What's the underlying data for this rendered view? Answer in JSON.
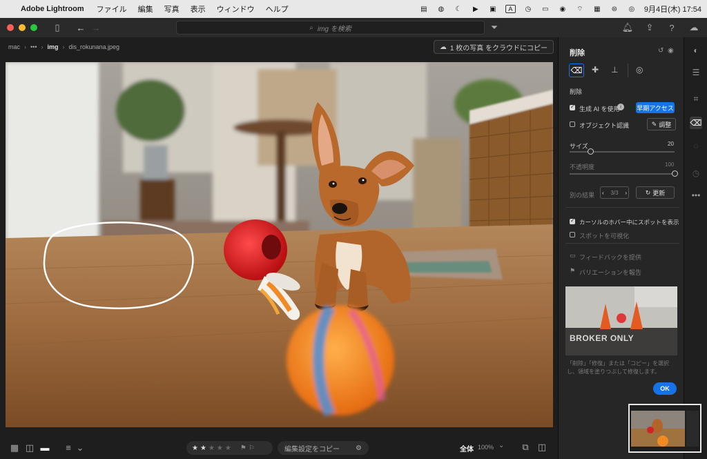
{
  "menubar": {
    "app_name": "Adobe Lightroom",
    "items": [
      "ファイル",
      "編集",
      "写真",
      "表示",
      "ウィンドウ",
      "ヘルプ"
    ],
    "clock": "9月4日(木)  17:54",
    "input_indicator": "A"
  },
  "toolbar": {
    "search_placeholder": "img を検索"
  },
  "breadcrumb": {
    "root": "mac",
    "ellipsis": "•••",
    "folder": "img",
    "file": "dis_rokunana.jpeg"
  },
  "cloud_button": "1 枚の写真 をクラウドにコピー",
  "bottombar": {
    "copy_settings": "編集設定をコピー",
    "zoom_mode": "全体",
    "zoom_value": "100%",
    "rating": 0
  },
  "panel": {
    "title": "削除",
    "section_label": "削除",
    "genai_label": "生成 AI を使用",
    "early_access": "早期アクセス",
    "object_detect": "オブジェクト認識",
    "adjust_button": "調整",
    "size_label": "サイズ",
    "size_value": "20",
    "size_fraction": 0.2,
    "opacity_label": "不透明度",
    "opacity_value": "100",
    "opacity_fraction": 1.0,
    "results_label": "別の結果",
    "results_count": "3/3",
    "refresh_button": "更新",
    "hover_spot": "カーソルのホバー中にスポットを表示",
    "visualize_spots": "スポットを可視化",
    "feedback": "フィードバックを提供",
    "report": "バリエーションを報告",
    "thumb_sign_text": "BROKER ONLY",
    "help_text": "「削除」「修復」または「コピー」を選択し、領域を塗りつぶして修復します。",
    "ok_button": "OK"
  },
  "colors": {
    "accent": "#1473e6",
    "panel_bg": "#262626",
    "app_bg": "#1e1e1e"
  }
}
